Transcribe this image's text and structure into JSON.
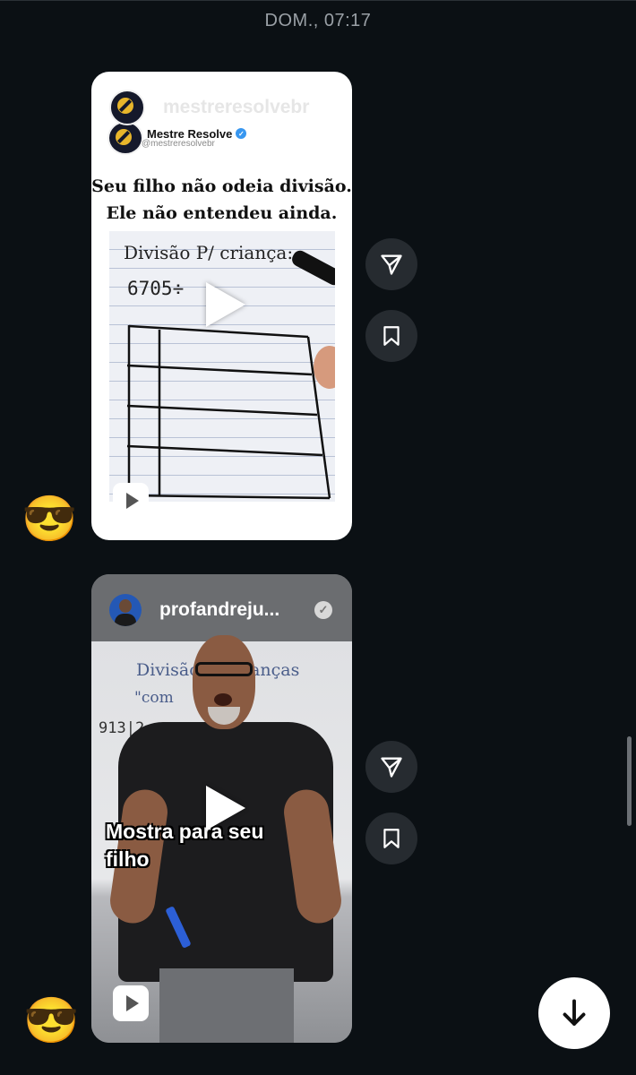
{
  "header": {
    "timestamp": "DOM., 07:17"
  },
  "messages": [
    {
      "sender_name": "mestreresolvebr",
      "post": {
        "account_name": "Mestre Resolve",
        "handle": "@mestreresolvebr",
        "headline_line1": "Seu filho não odeia divisão.",
        "headline_line2": "Ele não entendeu ainda.",
        "notebook_title": "Divisão P/ criança:",
        "notebook_number": "6705÷"
      },
      "reaction_emoji": "😎"
    },
    {
      "sender_name": "profandreju...",
      "verified_glyph": "✓",
      "whiteboard_line1": "Divisão p/ crianças",
      "whiteboard_line2": "\"com",
      "whiteboard_number": "913|2",
      "caption_line1": "Mostra para seu",
      "caption_line2": "filho",
      "reaction_emoji": "😎"
    }
  ],
  "icons": {
    "share": "paper-plane-icon",
    "save": "bookmark-icon",
    "play": "play-icon",
    "reel": "reel-icon",
    "scroll_down": "arrow-down-icon"
  },
  "colors": {
    "background": "#0b1014",
    "button": "#262b30",
    "verified": "#3897f0"
  }
}
